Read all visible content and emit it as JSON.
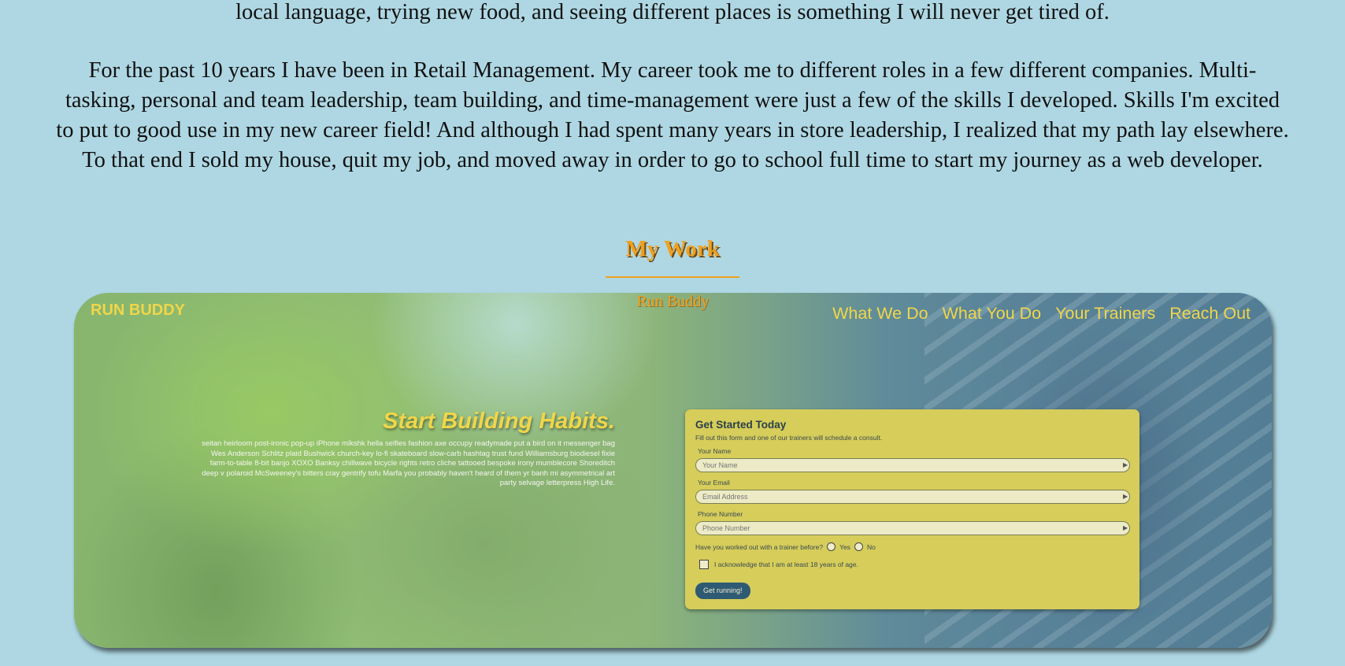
{
  "bio": {
    "paragraph_1_tail": "local language, trying new food, and seeing different places is something I will never get tired of.",
    "paragraph_2": "For the past 10 years I have been in Retail Management. My career took me to different roles in a few different companies. Multi-tasking, personal and team leadership, team building, and time-management were just a few of the skills I developed. Skills I'm excited to put to good use in my new career field! And although I had spent many years in store leadership, I realized that my path lay elsewhere. To that end I sold my house, quit my job, and moved away in order to go to school full time to start my journey as a web developer."
  },
  "work": {
    "heading": "My Work",
    "accent_color": "#f0a020"
  },
  "project": {
    "caption": "Run Buddy",
    "screenshot": {
      "brand": "RUN BUDDY",
      "nav": [
        "What We Do",
        "What You Do",
        "Your Trainers",
        "Reach Out"
      ],
      "hero_title": "Start Building Habits.",
      "hero_text": "seitan heirloom post-ironic pop-up iPhone mlkshk hella selfies fashion axe occupy readymade put a bird on it messenger bag Wes Anderson Schlitz plaid Bushwick church-key lo-fi skateboard slow-carb hashtag trust fund Williamsburg biodiesel fixie farm-to-table 8-bit banjo XOXO Banksy chillwave bicycle rights retro cliche tattooed bespoke irony mumblecore Shoreditch deep v polaroid McSweeney's bitters cray gentrify tofu Marfa you probably haven't heard of them yr banh mi asymmetrical art party selvage letterpress High Life.",
      "form": {
        "title": "Get Started Today",
        "subtitle": "Fill out this form and one of our trainers will schedule a consult.",
        "name_label": "Your Name",
        "name_placeholder": "Your Name",
        "email_label": "Your Email",
        "email_placeholder": "Email Address",
        "phone_label": "Phone Number",
        "phone_placeholder": "Phone Number",
        "trainer_question": "Have you worked out with a trainer before?",
        "yes_label": "Yes",
        "no_label": "No",
        "age_ack": "I acknowledge that I am at least 18 years of age.",
        "submit_label": "Get running!"
      }
    }
  }
}
